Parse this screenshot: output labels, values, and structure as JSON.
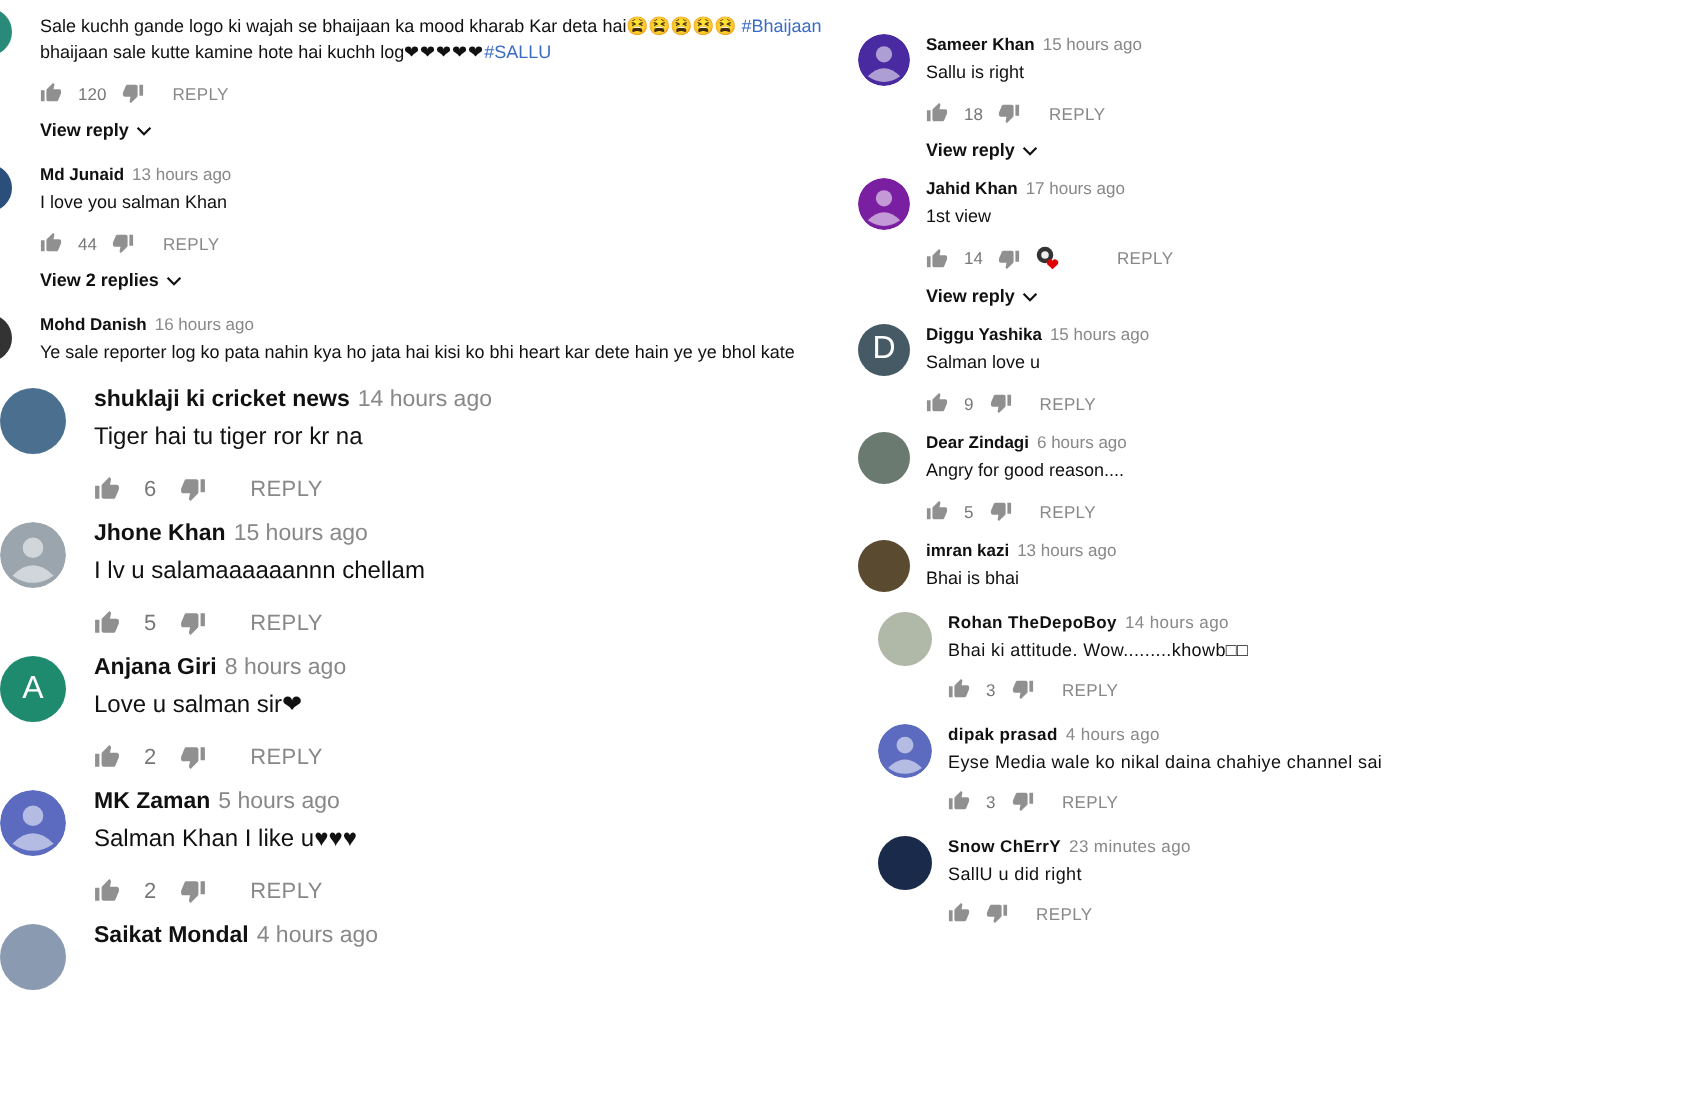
{
  "left_column": [
    {
      "kind": "compact",
      "comments": [
        {
          "avatar": {
            "kind": "photo",
            "color": "#2a8a7a"
          },
          "parts": [
            {
              "kind": "text",
              "t": "Sale kuchh gande logo ki wajah se bhaijaan ka mood kharab Kar deta hai😫😫😫😫😫 "
            },
            {
              "kind": "hashtag",
              "t": "#Bhaijaan"
            },
            {
              "kind": "text",
              "t": " bhaijaan sale kutte kamine hote hai kuchh log❤❤❤❤❤"
            },
            {
              "kind": "hashtag",
              "t": "#SALLU"
            }
          ],
          "likes": "120",
          "reply": "REPLY",
          "view_replies": "View reply"
        },
        {
          "avatar": {
            "kind": "photo",
            "color": "#2a4f7a"
          },
          "author": "Md Junaid",
          "time": "13 hours ago",
          "text": "I love you salman Khan",
          "likes": "44",
          "reply": "REPLY",
          "view_replies": "View 2 replies"
        },
        {
          "avatar": {
            "kind": "photo",
            "color": "#333333"
          },
          "author": "Mohd Danish",
          "time": "16 hours ago",
          "text": "Ye sale reporter log ko pata nahin kya ho jata hai kisi ko bhi heart kar dete hain ye ye bhol kate"
        }
      ]
    },
    {
      "kind": "large",
      "comments": [
        {
          "avatar": {
            "kind": "photo",
            "color": "#4a6f8f"
          },
          "author": "shuklaji ki cricket news",
          "time": "14 hours ago",
          "text": "Tiger hai tu tiger ror kr na",
          "likes": "6",
          "reply": "REPLY"
        },
        {
          "avatar": {
            "kind": "silhouette",
            "color": "#9aa5ad"
          },
          "author": "Jhone Khan",
          "time": "15 hours ago",
          "text": "I lv u salamaaaaaannn chellam",
          "likes": "5",
          "reply": "REPLY"
        },
        {
          "avatar": {
            "kind": "letter",
            "letter": "A",
            "color": "#1e8a6e"
          },
          "author": "Anjana Giri",
          "time": "8 hours ago",
          "text": "Love u salman sir❤",
          "likes": "2",
          "reply": "REPLY"
        },
        {
          "avatar": {
            "kind": "silhouette",
            "color": "#5c6bc0"
          },
          "author": "MK Zaman",
          "time": "5 hours ago",
          "text": "Salman Khan I like u♥♥♥",
          "likes": "2",
          "reply": "REPLY"
        },
        {
          "avatar": {
            "kind": "photo",
            "color": "#8a9ab0"
          },
          "author": "Saikat Mondal",
          "time": "4 hours ago"
        }
      ]
    }
  ],
  "right_column": [
    {
      "kind": "compact",
      "comments": [
        {
          "avatar": {
            "kind": "silhouette",
            "color": "#4a2aa0"
          },
          "author": "Sameer Khan",
          "time": "15 hours ago",
          "text": "Sallu  is right",
          "likes": "18",
          "reply": "REPLY",
          "view_replies": "View reply"
        },
        {
          "avatar": {
            "kind": "silhouette",
            "color": "#7b1fa2"
          },
          "author": "Jahid Khan",
          "time": "17 hours ago",
          "text": "1st view",
          "likes": "14",
          "hearted": true,
          "reply": "REPLY",
          "view_replies": "View reply"
        },
        {
          "avatar": {
            "kind": "letter",
            "letter": "D",
            "color": "#455a64"
          },
          "author": "Diggu Yashika",
          "time": "15 hours ago",
          "text": "Salman love u",
          "likes": "9",
          "reply": "REPLY"
        },
        {
          "avatar": {
            "kind": "photo",
            "color": "#6a7a70"
          },
          "author": "Dear Zindagi",
          "time": "6 hours ago",
          "text": "Angry for good reason....",
          "likes": "5",
          "reply": "REPLY"
        },
        {
          "avatar": {
            "kind": "photo",
            "color": "#5a4a30"
          },
          "author": "imran kazi",
          "time": "13 hours ago",
          "text": "Bhai is bhai"
        }
      ]
    },
    {
      "kind": "reply",
      "comments": [
        {
          "avatar": {
            "kind": "photo",
            "color": "#b0b8a8"
          },
          "author": "Rohan TheDepoBoy",
          "time": "14 hours ago",
          "text": "Bhai ki attitude.    Wow.........khowb□□",
          "likes": "3",
          "reply": "REPLY"
        },
        {
          "avatar": {
            "kind": "silhouette",
            "color": "#5c6bc0"
          },
          "author": "dipak prasad",
          "time": "4 hours ago",
          "text": "Eyse Media wale  ko nikal daina chahiye channel sai",
          "likes": "3",
          "reply": "REPLY"
        },
        {
          "avatar": {
            "kind": "photo",
            "color": "#1a2a4a"
          },
          "author": "Snow ChErrY",
          "time": "23 minutes ago",
          "text": "SallU u did right",
          "reply": "REPLY"
        }
      ]
    }
  ]
}
